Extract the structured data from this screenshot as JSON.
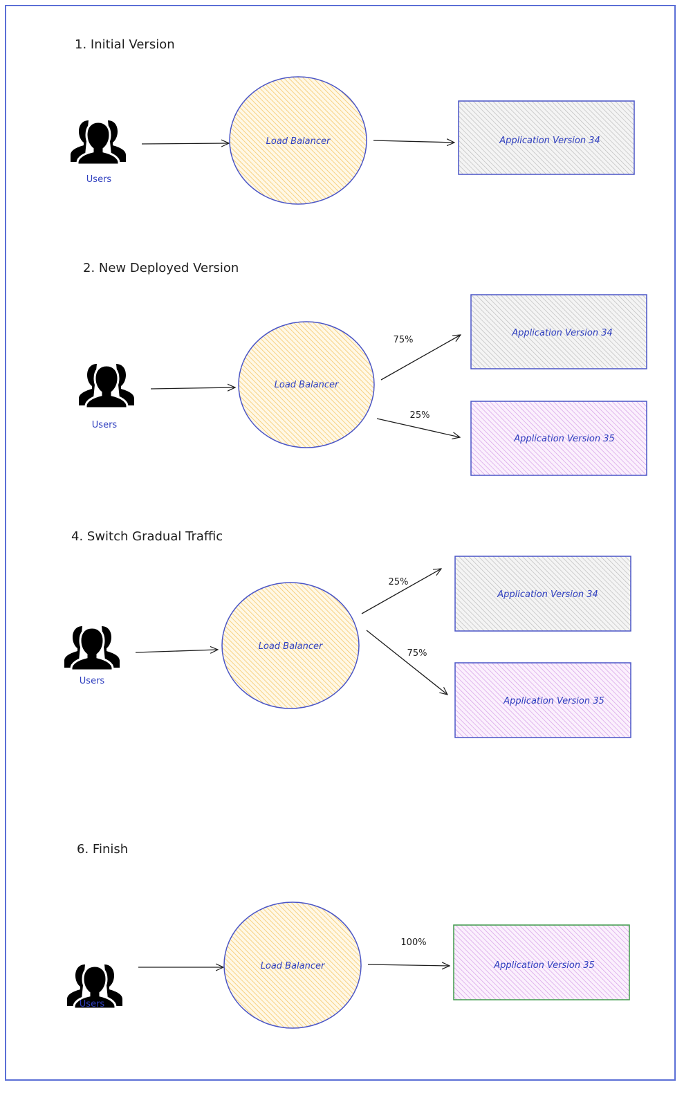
{
  "colors": {
    "frame": "#5b6fd6",
    "stroke_blue": "#4a55c7",
    "lb_fill": "#ffe3a3",
    "v34_fill": "#d9d9d9",
    "v35_fill": "#e6b8f0",
    "finish_border": "#3f9a4a",
    "text_blue": "#2f3fbf",
    "arrow": "#1e1e1e"
  },
  "sections": [
    {
      "title": "1. Initial Version",
      "users_label": "Users",
      "lb_label": "Load Balancer",
      "targets": [
        {
          "label": "Application Version 34",
          "version": 34,
          "traffic": null
        }
      ]
    },
    {
      "title": "2. New Deployed Version",
      "users_label": "Users",
      "lb_label": "Load Balancer",
      "targets": [
        {
          "label": "Application Version 34",
          "version": 34,
          "traffic": "75%"
        },
        {
          "label": "Application Version 35",
          "version": 35,
          "traffic": "25%"
        }
      ]
    },
    {
      "title": "4. Switch Gradual Traffic",
      "users_label": "Users",
      "lb_label": "Load Balancer",
      "targets": [
        {
          "label": "Application Version 34",
          "version": 34,
          "traffic": "25%"
        },
        {
          "label": "Application Version 35",
          "version": 35,
          "traffic": "75%"
        }
      ]
    },
    {
      "title": "6. Finish",
      "users_label": "Users",
      "lb_label": "Load Balancer",
      "targets": [
        {
          "label": "Application Version 35",
          "version": 35,
          "traffic": "100%"
        }
      ]
    }
  ]
}
